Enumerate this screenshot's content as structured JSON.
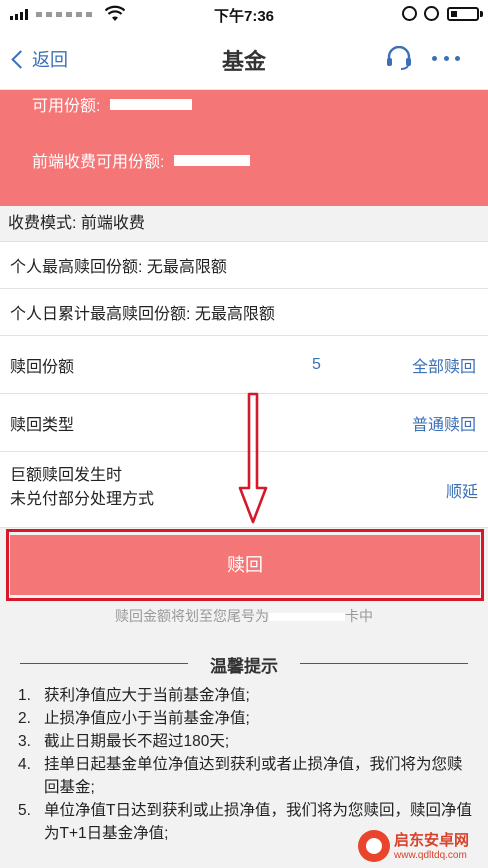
{
  "status_bar": {
    "time": "下午7:36",
    "icons": [
      "signal-icon",
      "wifi-icon",
      "orientation-lock-icon",
      "alarm-icon",
      "battery-icon"
    ]
  },
  "nav": {
    "back_label": "返回",
    "title": "基金",
    "icons": [
      "chevron-left-icon",
      "headset-icon",
      "more-icon"
    ]
  },
  "shares": {
    "available_label": "可用份额:",
    "front_end_available_label": "前端收费可用份额:"
  },
  "fee_mode": "收费模式: 前端收费",
  "limits": {
    "max_personal": "个人最高赎回份额:  无最高限额",
    "daily_cumulative": "个人日累计最高赎回份额:  无最高限额"
  },
  "form": {
    "redeem_shares_label": "赎回份额",
    "redeem_shares_value": "5",
    "redeem_all_label": "全部赎回",
    "redeem_type_label": "赎回类型",
    "redeem_type_value": "普通赎回",
    "large_redeem_line1": "巨额赎回发生时",
    "large_redeem_line2": "未兑付部分处理方式",
    "large_redeem_value": "顺延"
  },
  "redeem_button": "赎回",
  "redeem_note_prefix": "赎回金额将划至您尾号为",
  "redeem_note_suffix": "卡中",
  "tips": {
    "title": "温馨提示",
    "items": [
      {
        "num": "1.",
        "text": "获利净值应大于当前基金净值;"
      },
      {
        "num": "2.",
        "text": "止损净值应小于当前基金净值;"
      },
      {
        "num": "3.",
        "text": "截止日期最长不超过180天;"
      },
      {
        "num": "4.",
        "text": "挂单日起基金单位净值达到获利或者止损净值，我们将为您赎回基金;"
      },
      {
        "num": "5.",
        "text": "单位净值T日达到获利或止损净值，我们将为您赎回，赎回净值为T+1日基金净值;"
      }
    ]
  },
  "watermark": {
    "title": "启东安卓网",
    "url": "www.qdltdq.com"
  },
  "colors": {
    "accent": "#f57676",
    "link": "#3b6fb6",
    "highlight_frame": "#d6182a"
  }
}
